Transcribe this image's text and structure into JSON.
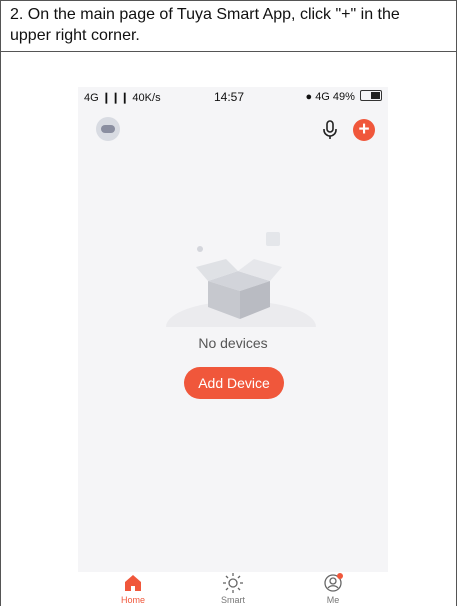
{
  "instruction": "2. On the main page of Tuya Smart App, click \"+\" in the upper right corner.",
  "status_bar": {
    "left": "4G ❙❙❙ 40K/s",
    "time": "14:57",
    "right": "4G 49%"
  },
  "empty_state": {
    "message": "No devices"
  },
  "add_device_label": "Add Device",
  "tabs": [
    {
      "label": "Home",
      "icon": "home-icon",
      "active": true
    },
    {
      "label": "Smart",
      "icon": "sun-icon",
      "active": false
    },
    {
      "label": "Me",
      "icon": "profile-icon",
      "active": false
    }
  ],
  "colors": {
    "accent": "#f0573b",
    "background": "#f5f5f7"
  }
}
